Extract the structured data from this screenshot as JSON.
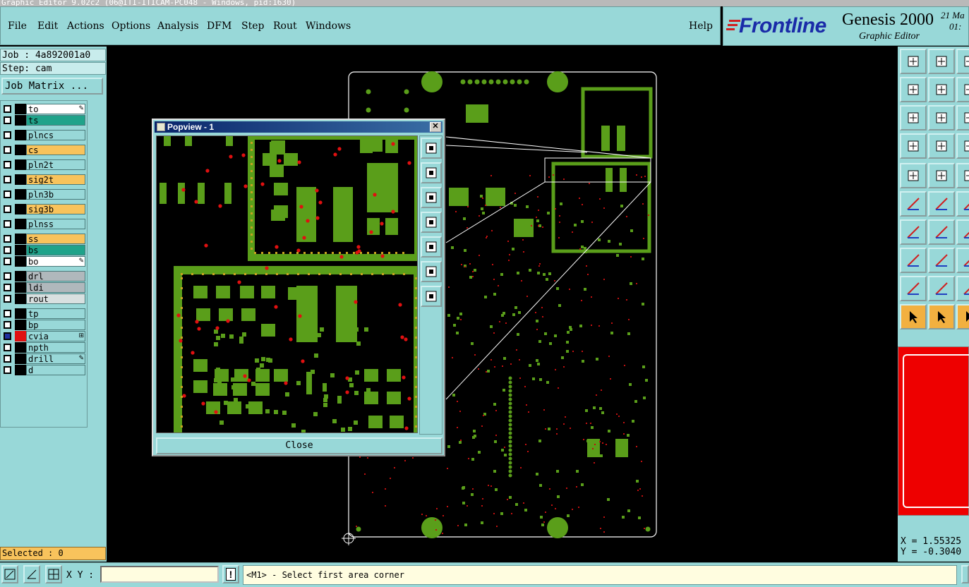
{
  "window": {
    "title": "Graphic Editor 9.02c2 (06@ITI-ITICAM-PC048 - Windows, pid:1630)"
  },
  "menu": {
    "items": [
      "File",
      "Edit",
      "Actions",
      "Options",
      "Analysis",
      "DFM",
      "Step",
      "Rout",
      "Windows"
    ],
    "help": "Help"
  },
  "brand": {
    "logo": "Frontline",
    "product": "Genesis 2000",
    "subtitle": "Graphic Editor",
    "date_line1": "21 Ma",
    "date_line2": "01:"
  },
  "job": {
    "job_line": "Job : 4a892001a0",
    "step_line": "Step: cam",
    "matrix_button": "Job Matrix ..."
  },
  "layers": [
    {
      "name": "to",
      "color": "#ffffff",
      "icon": "edit-icon"
    },
    {
      "name": "ts",
      "color": "#1fa38a"
    },
    {
      "name": "plncs",
      "color": "#98d8d8"
    },
    {
      "name": "cs",
      "color": "#f8c35c"
    },
    {
      "name": "pln2t",
      "color": "#98d8d8"
    },
    {
      "name": "sig2t",
      "color": "#f8c35c"
    },
    {
      "name": "pln3b",
      "color": "#98d8d8"
    },
    {
      "name": "sig3b",
      "color": "#f8c35c"
    },
    {
      "name": "plnss",
      "color": "#98d8d8"
    },
    {
      "name": "ss",
      "color": "#f8c35c"
    },
    {
      "name": "bs",
      "color": "#1fa38a"
    },
    {
      "name": "bo",
      "color": "#ffffff",
      "icon": "edit-icon"
    },
    {
      "name": "drl",
      "color": "#b0b8bc"
    },
    {
      "name": "ldi",
      "color": "#b0b8bc"
    },
    {
      "name": "rout",
      "color": "#d8e0e0"
    },
    {
      "name": "tp",
      "color": "#98d8d8"
    },
    {
      "name": "bp",
      "color": "#98d8d8"
    },
    {
      "name": "cvia",
      "color": "#98d8d8",
      "icon": "grid-icon",
      "active": true
    },
    {
      "name": "npth",
      "color": "#98d8d8"
    },
    {
      "name": "drill",
      "color": "#98d8d8",
      "icon": "edit-icon"
    },
    {
      "name": "d",
      "color": "#98d8d8"
    }
  ],
  "selected": "Selected : 0",
  "popview": {
    "title": "Popview - 1",
    "close_label": "Close"
  },
  "status": {
    "xy_label": "X Y :",
    "xy_value": "",
    "prompt": "<M1> - Select first area corner"
  },
  "coords": {
    "x": "X = 1.55325",
    "y": "Y = -0.3040"
  },
  "colors": {
    "panel": "#98d8d8",
    "copper": "#5a9e1a",
    "pad_red": "#e01010",
    "accent_orange": "#f8c35c"
  }
}
